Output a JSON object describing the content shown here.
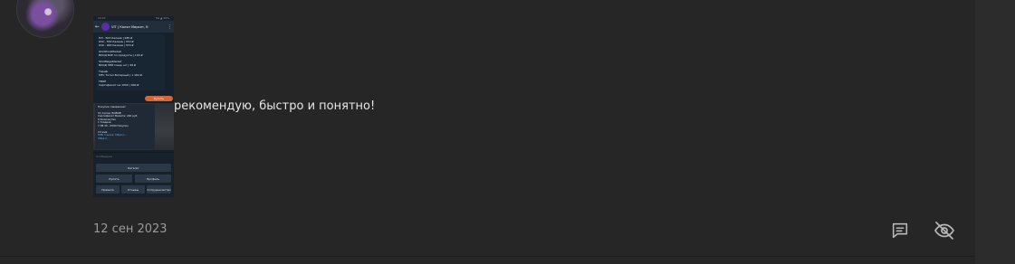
{
  "review": {
    "text": "рекомендую, быстро и понятно!",
    "date": "12 сен 2023"
  },
  "attachment": {
    "status_time": "15:07",
    "status_right": "5G ▲ 55%",
    "chat_title": "VIT | Калян Маркет, б",
    "price_lines": [
      "ПЛ - 503 Калиев | 285 ₽",
      "630 - 553 Калиев | 370 ₽",
      "630 - 963 Калиев | 370 ₽",
      "",
      "ShotHookMarket",
      "ВХОД ВСЕ по продукты | 100 ₽",
      "",
      "ShotMegaMarket",
      "ВХОД ЗЕЙ товар шт | 99 ₽",
      "",
      "Тариф",
      "МТС Тотал Витарный | 1 184 ₽",
      "",
      "ТВОЕ",
      "Сертификат на 1000 | 900 ₽"
    ],
    "buy_button": "Купить",
    "order_lines": [
      "Покупка совершена!",
      "",
      "С1 Склад: ВОВОВ",
      "Сертификат Валюта: 240 руб",
      "0 Количество",
      "1 Товаров",
      "7:38 30 - 0500 Покупок",
      "",
      "С3 sale",
      "ПЭБ ссылка: https://...",
      "https://..."
    ],
    "input_placeholder": "Сообщение",
    "keys": {
      "main": "Каталог",
      "buy": "Купить",
      "profile": "Профиль",
      "rules": "Правила",
      "reviews": "Отзывы",
      "support": "Сотрудничество"
    }
  },
  "actions": {
    "comment_icon": "comment-icon",
    "hide_icon": "eye-off-icon"
  }
}
